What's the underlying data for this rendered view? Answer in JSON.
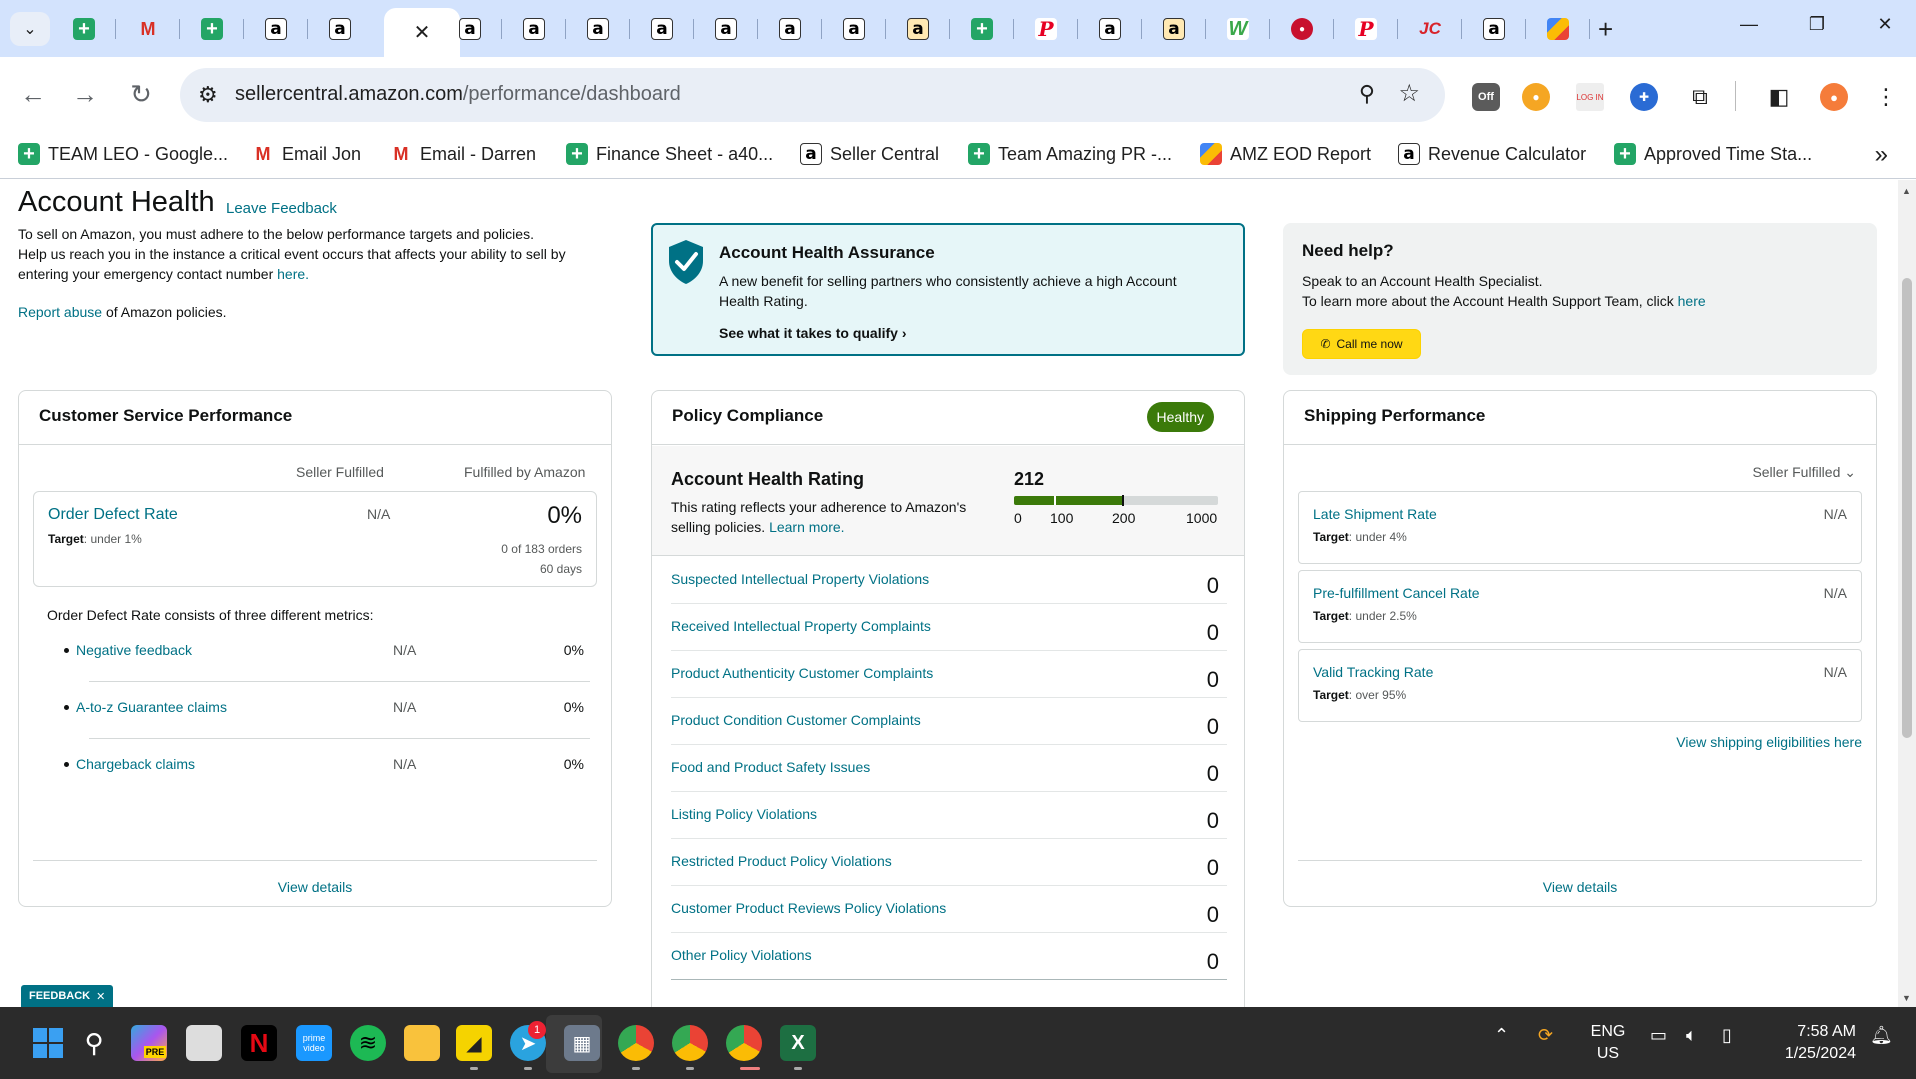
{
  "browser": {
    "url_host": "sellercentral.amazon.com",
    "url_path": "/performance/dashboard",
    "bookmarks": [
      {
        "label": "TEAM LEO - Google...",
        "icon": "sheets-icon"
      },
      {
        "label": "Email Jon",
        "icon": "gmail-icon"
      },
      {
        "label": "Email - Darren",
        "icon": "gmail-icon"
      },
      {
        "label": "Finance Sheet - a40...",
        "icon": "sheets-icon"
      },
      {
        "label": "Seller Central",
        "icon": "amazon-icon"
      },
      {
        "label": "Team Amazing PR -...",
        "icon": "sheets-icon"
      },
      {
        "label": "AMZ EOD Report",
        "icon": "multicolor-icon"
      },
      {
        "label": "Revenue Calculator",
        "icon": "amazon-icon"
      },
      {
        "label": "Approved Time Sta...",
        "icon": "sheets-icon"
      }
    ],
    "ext_off_label": "Off"
  },
  "page": {
    "title": "Account Health",
    "leave_feedback": "Leave Feedback",
    "intro_line1": "To sell on Amazon, you must adhere to the below performance targets and policies.",
    "intro_line2": "Help us reach you in the instance a critical event occurs that affects your ability to sell by entering your emergency contact number",
    "intro_here": "here.",
    "report_link": "Report abuse",
    "report_rest": " of Amazon policies."
  },
  "assurance": {
    "title": "Account Health Assurance",
    "text": "A new benefit for selling partners who consistently achieve a high Account Health Rating.",
    "link": "See what it takes to qualify"
  },
  "help": {
    "title": "Need help?",
    "line1": "Speak to an Account Health Specialist.",
    "line2": "To learn more about the Account Health Support Team, click",
    "line2_link": "here",
    "call_button": "Call me now"
  },
  "customer_service": {
    "title": "Customer Service Performance",
    "col1": "Seller Fulfilled",
    "col2": "Fulfilled by Amazon",
    "odr_name": "Order Defect Rate",
    "odr_target_label": "Target",
    "odr_target_value": ": under 1%",
    "odr_seller": "N/A",
    "odr_fba": "0%",
    "odr_orders": "0 of 183 orders",
    "odr_days": "60 days",
    "description": "Order Defect Rate consists of three different metrics:",
    "metrics": [
      {
        "name": "Negative feedback",
        "seller": "N/A",
        "fba": "0%"
      },
      {
        "name": "A-to-z Guarantee claims",
        "seller": "N/A",
        "fba": "0%"
      },
      {
        "name": "Chargeback claims",
        "seller": "N/A",
        "fba": "0%"
      }
    ],
    "view_details": "View details"
  },
  "policy": {
    "title": "Policy Compliance",
    "status": "Healthy",
    "rating_title": "Account Health Rating",
    "rating_text": "This rating reflects your adherence to Amazon's selling policies.",
    "rating_link": "Learn more.",
    "rating_score": "212",
    "rating_value": 212,
    "ticks": [
      "0",
      "100",
      "200",
      "1000"
    ],
    "items": [
      {
        "name": "Suspected Intellectual Property Violations",
        "count": "0"
      },
      {
        "name": "Received Intellectual Property Complaints",
        "count": "0"
      },
      {
        "name": "Product Authenticity Customer Complaints",
        "count": "0"
      },
      {
        "name": "Product Condition Customer Complaints",
        "count": "0"
      },
      {
        "name": "Food and Product Safety Issues",
        "count": "0"
      },
      {
        "name": "Listing Policy Violations",
        "count": "0"
      },
      {
        "name": "Restricted Product Policy Violations",
        "count": "0"
      },
      {
        "name": "Customer Product Reviews Policy Violations",
        "count": "0"
      },
      {
        "name": "Other Policy Violations",
        "count": "0"
      }
    ]
  },
  "shipping": {
    "title": "Shipping Performance",
    "selector": "Seller Fulfilled",
    "metrics": [
      {
        "name": "Late Shipment Rate",
        "target_label": "Target",
        "target_value": ": under 4%",
        "value": "N/A"
      },
      {
        "name": "Pre-fulfillment Cancel Rate",
        "target_label": "Target",
        "target_value": ": under 2.5%",
        "value": "N/A"
      },
      {
        "name": "Valid Tracking Rate",
        "target_label": "Target",
        "target_value": ": over 95%",
        "value": "N/A"
      }
    ],
    "eligibility_link": "View shipping eligibilities here",
    "view_details": "View details"
  },
  "feedback_tab": "FEEDBACK",
  "taskbar": {
    "language": "ENG",
    "region": "US",
    "time": "7:58 AM",
    "date": "1/25/2024",
    "telegram_badge": "1",
    "copilot_badge": "PRE",
    "prime_label": "prime video"
  }
}
